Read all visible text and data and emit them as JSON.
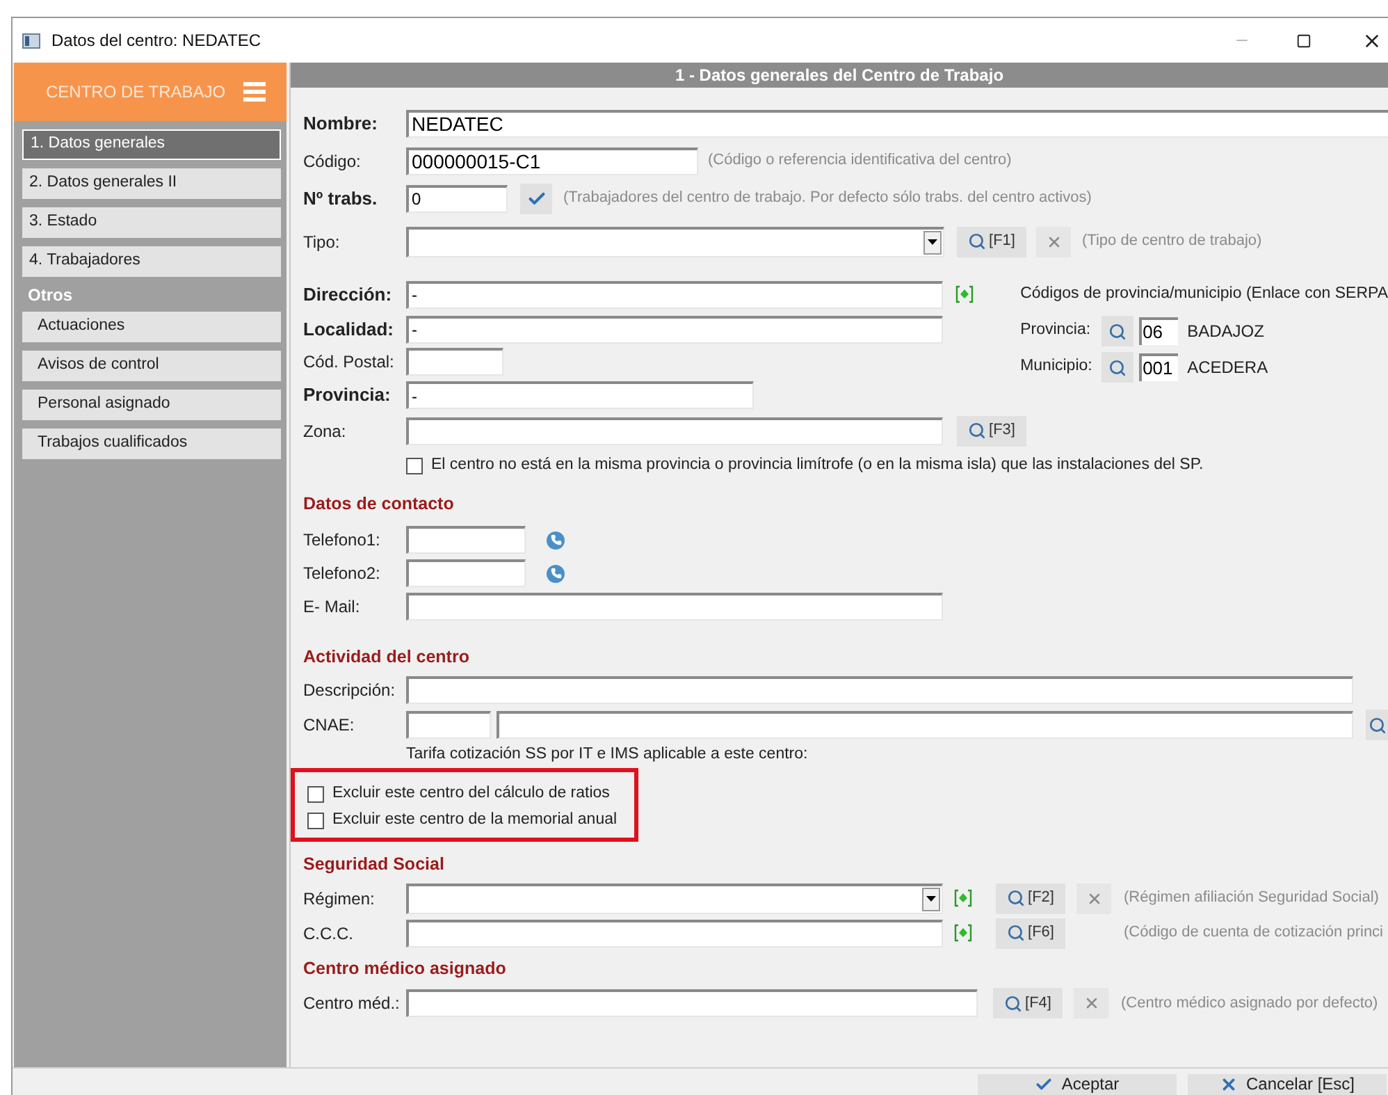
{
  "window": {
    "title": "Datos del centro: NEDATEC"
  },
  "sidebar": {
    "header": "CENTRO DE TRABAJO",
    "items": [
      {
        "label": "1. Datos generales",
        "selected": true
      },
      {
        "label": "2. Datos generales II",
        "selected": false
      },
      {
        "label": "3. Estado",
        "selected": false
      },
      {
        "label": "4. Trabajadores",
        "selected": false
      }
    ],
    "group_title": "Otros",
    "group_items": [
      {
        "label": "Actuaciones",
        "selected": false
      },
      {
        "label": "Avisos de control",
        "selected": false
      },
      {
        "label": "Personal asignado",
        "selected": false
      },
      {
        "label": "Trabajos cualificados",
        "selected": false
      }
    ]
  },
  "panel_title": "1 - Datos generales del Centro de Trabajo",
  "general": {
    "name": {
      "label": "Nombre:",
      "value": "NEDATEC"
    },
    "code": {
      "label": "Código:",
      "value": "000000015-C1",
      "hint": "(Código o referencia identificativa del centro)"
    },
    "workers": {
      "label": "Nº trabs.",
      "value": "0",
      "hint": "(Trabajadores del centro de trabajo. Por defecto sólo trabs. del centro activos)"
    },
    "type": {
      "label": "Tipo:",
      "lookup_key": "[F1]",
      "hint": "(Tipo de centro de trabajo)"
    },
    "address": {
      "label": "Dirección:",
      "value": "-"
    },
    "locality": {
      "label": "Localidad:",
      "value": "-"
    },
    "postal_code": {
      "label": "Cód. Postal:"
    },
    "province": {
      "label": "Provincia:",
      "value": "-"
    },
    "zone": {
      "label": "Zona:",
      "lookup_key": "[F3]"
    },
    "outside_province": {
      "label": "El centro no está en la misma provincia o provincia limítrofe (o en la misma isla) que las instalaciones del SP.",
      "checked": false
    },
    "serpa": {
      "title": "Códigos de provincia/municipio (Enlace con SERPA",
      "province": {
        "label": "Provincia:",
        "code": "06",
        "name": "BADAJOZ"
      },
      "municipality": {
        "label": "Municipio:",
        "code": "001",
        "name": "ACEDERA"
      }
    }
  },
  "contact": {
    "title": "Datos de contacto",
    "phone1": {
      "label": "Telefono1:"
    },
    "phone2": {
      "label": "Telefono2:"
    },
    "email": {
      "label": "E- Mail:"
    }
  },
  "activity": {
    "title": "Actividad del centro",
    "description": {
      "label": "Descripción:"
    },
    "cnae": {
      "label": "CNAE:"
    },
    "tariff_note": "Tarifa cotización SS por IT e IMS aplicable a este centro:",
    "exclusions": {
      "highlighted": true,
      "items": [
        {
          "label": "Excluir este centro del cálculo de ratios",
          "checked": false
        },
        {
          "label": "Excluir este centro de la memorial anual",
          "checked": false
        }
      ]
    }
  },
  "social_security": {
    "title": "Seguridad Social",
    "regime": {
      "label": "Régimen:",
      "lookup_key": "[F2]",
      "hint": "(Régimen afiliación Seguridad Social)"
    },
    "ccc": {
      "label": "C.C.C.",
      "lookup_key": "[F6]",
      "hint": "(Código de cuenta de cotización princi"
    }
  },
  "medical": {
    "title": "Centro médico asignado",
    "center": {
      "label": "Centro méd.:",
      "lookup_key": "[F4]",
      "hint": "(Centro médico asignado por defecto)"
    }
  },
  "buttons": [
    {
      "label": "Aceptar",
      "kind": "accept"
    },
    {
      "label": "Cancelar [Esc]",
      "kind": "cancel"
    }
  ]
}
